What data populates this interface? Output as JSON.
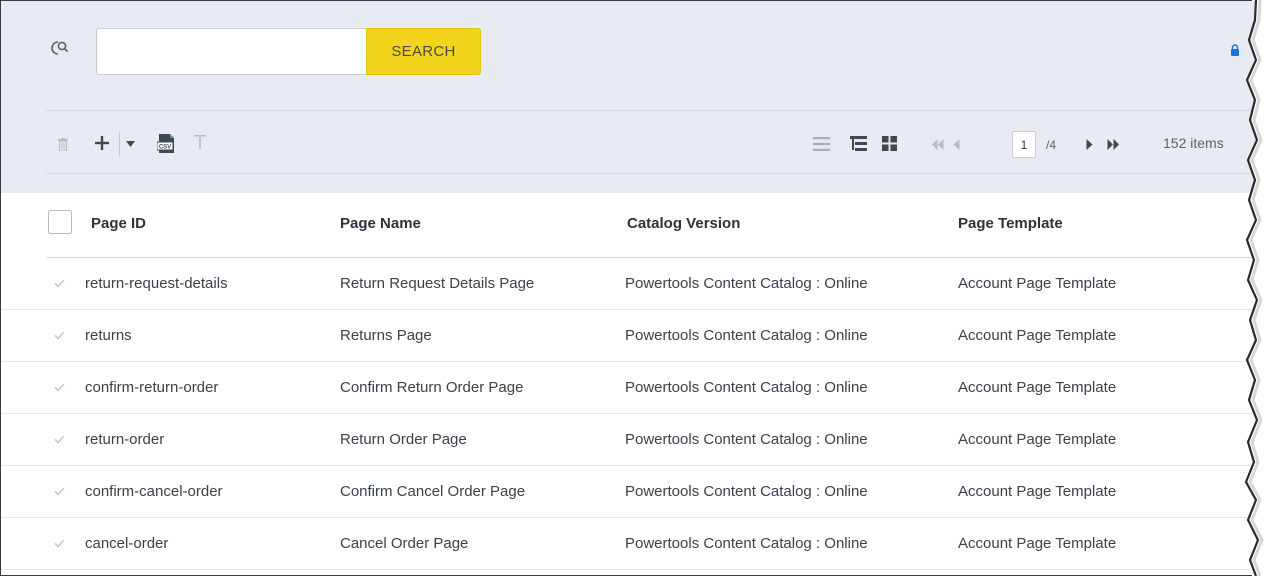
{
  "search": {
    "placeholder": "",
    "value": "",
    "button_label": "SEARCH"
  },
  "toolbar": {
    "left_icons": [
      "trash-icon",
      "add-icon",
      "caret-down-icon",
      "csv-export-icon",
      "text-filter-icon"
    ],
    "view_icons": [
      "list-view-icon",
      "tree-view-icon",
      "grid-view-icon"
    ]
  },
  "pagination": {
    "current_page": "1",
    "total_pages": "/4",
    "item_count": "152 items"
  },
  "table": {
    "columns": [
      "Page ID",
      "Page Name",
      "Catalog Version",
      "Page Template"
    ],
    "rows": [
      {
        "id": "return-request-details",
        "name": "Return Request Details Page",
        "catalog": "Powertools Content Catalog : Online",
        "template": "Account Page Template"
      },
      {
        "id": "returns",
        "name": "Returns Page",
        "catalog": "Powertools Content Catalog : Online",
        "template": "Account Page Template"
      },
      {
        "id": "confirm-return-order",
        "name": "Confirm Return Order Page",
        "catalog": "Powertools Content Catalog : Online",
        "template": "Account Page Template"
      },
      {
        "id": "return-order",
        "name": "Return Order Page",
        "catalog": "Powertools Content Catalog : Online",
        "template": "Account Page Template"
      },
      {
        "id": "confirm-cancel-order",
        "name": "Confirm Cancel Order Page",
        "catalog": "Powertools Content Catalog : Online",
        "template": "Account Page Template"
      },
      {
        "id": "cancel-order",
        "name": "Cancel Order Page",
        "catalog": "Powertools Content Catalog : Online",
        "template": "Account Page Template"
      }
    ]
  },
  "colors": {
    "header_bg": "#e8ecf2",
    "search_button": "#f2d51c",
    "lock_icon": "#1b6fd6",
    "text": "#3a414b"
  }
}
